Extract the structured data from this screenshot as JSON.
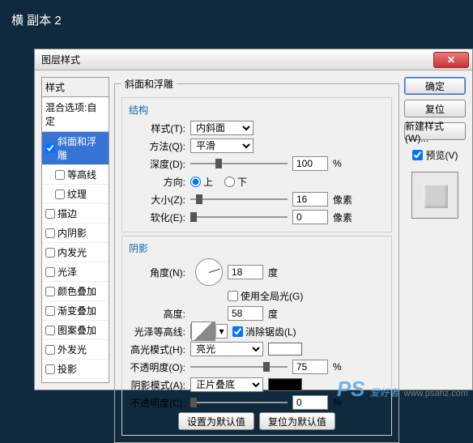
{
  "app_title": "横 副本 2",
  "dialog_title": "图层样式",
  "styles_header": "样式",
  "blend_options_label": "混合选项:自定",
  "styles": [
    {
      "key": "bevel",
      "label": "斜面和浮雕",
      "checked": true,
      "selected": true
    },
    {
      "key": "contour",
      "label": "等高线",
      "checked": false,
      "sub": true
    },
    {
      "key": "texture",
      "label": "纹理",
      "checked": false,
      "sub": true
    },
    {
      "key": "stroke",
      "label": "描边",
      "checked": false
    },
    {
      "key": "inner-shadow",
      "label": "内阴影",
      "checked": false
    },
    {
      "key": "inner-glow",
      "label": "内发光",
      "checked": false
    },
    {
      "key": "satin",
      "label": "光泽",
      "checked": false
    },
    {
      "key": "color-overlay",
      "label": "颜色叠加",
      "checked": false
    },
    {
      "key": "gradient-overlay",
      "label": "渐变叠加",
      "checked": false
    },
    {
      "key": "pattern-overlay",
      "label": "图案叠加",
      "checked": false
    },
    {
      "key": "outer-glow",
      "label": "外发光",
      "checked": false
    },
    {
      "key": "drop-shadow",
      "label": "投影",
      "checked": false
    }
  ],
  "section_title": "斜面和浮雕",
  "structure": {
    "heading": "结构",
    "style_label": "样式(T):",
    "style_value": "内斜面",
    "technique_label": "方法(Q):",
    "technique_value": "平滑",
    "depth_label": "深度(D):",
    "depth_value": "100",
    "percent": "%",
    "direction_label": "方向:",
    "direction_up": "上",
    "direction_down": "下",
    "direction_selected": "up",
    "size_label": "大小(Z):",
    "size_value": "16",
    "soften_label": "软化(E):",
    "soften_value": "0",
    "px": "像素"
  },
  "shading": {
    "heading": "阴影",
    "angle_label": "角度(N):",
    "angle_value": "18",
    "degree": "度",
    "global_light_label": "使用全局光(G)",
    "global_light_checked": false,
    "altitude_label": "高度:",
    "altitude_value": "58",
    "gloss_label": "光泽等高线:",
    "antialias_label": "消除锯齿(L)",
    "antialias_checked": true,
    "highlight_mode_label": "高光模式(H):",
    "highlight_mode_value": "亮光",
    "highlight_opacity_label": "不透明度(O):",
    "highlight_opacity_value": "75",
    "shadow_mode_label": "阴影模式(A):",
    "shadow_mode_value": "正片叠底",
    "shadow_opacity_label": "不透明度(C):",
    "shadow_opacity_value": "0"
  },
  "buttons": {
    "ok": "确定",
    "cancel": "复位",
    "new_style": "新建样式(W)...",
    "preview_label": "预览(V)",
    "preview_checked": true,
    "make_default": "设置为默认值",
    "reset_default": "复位为默认值"
  },
  "watermark": {
    "brand": "PS",
    "text": "爱好者",
    "url": "www.psahz.com"
  }
}
